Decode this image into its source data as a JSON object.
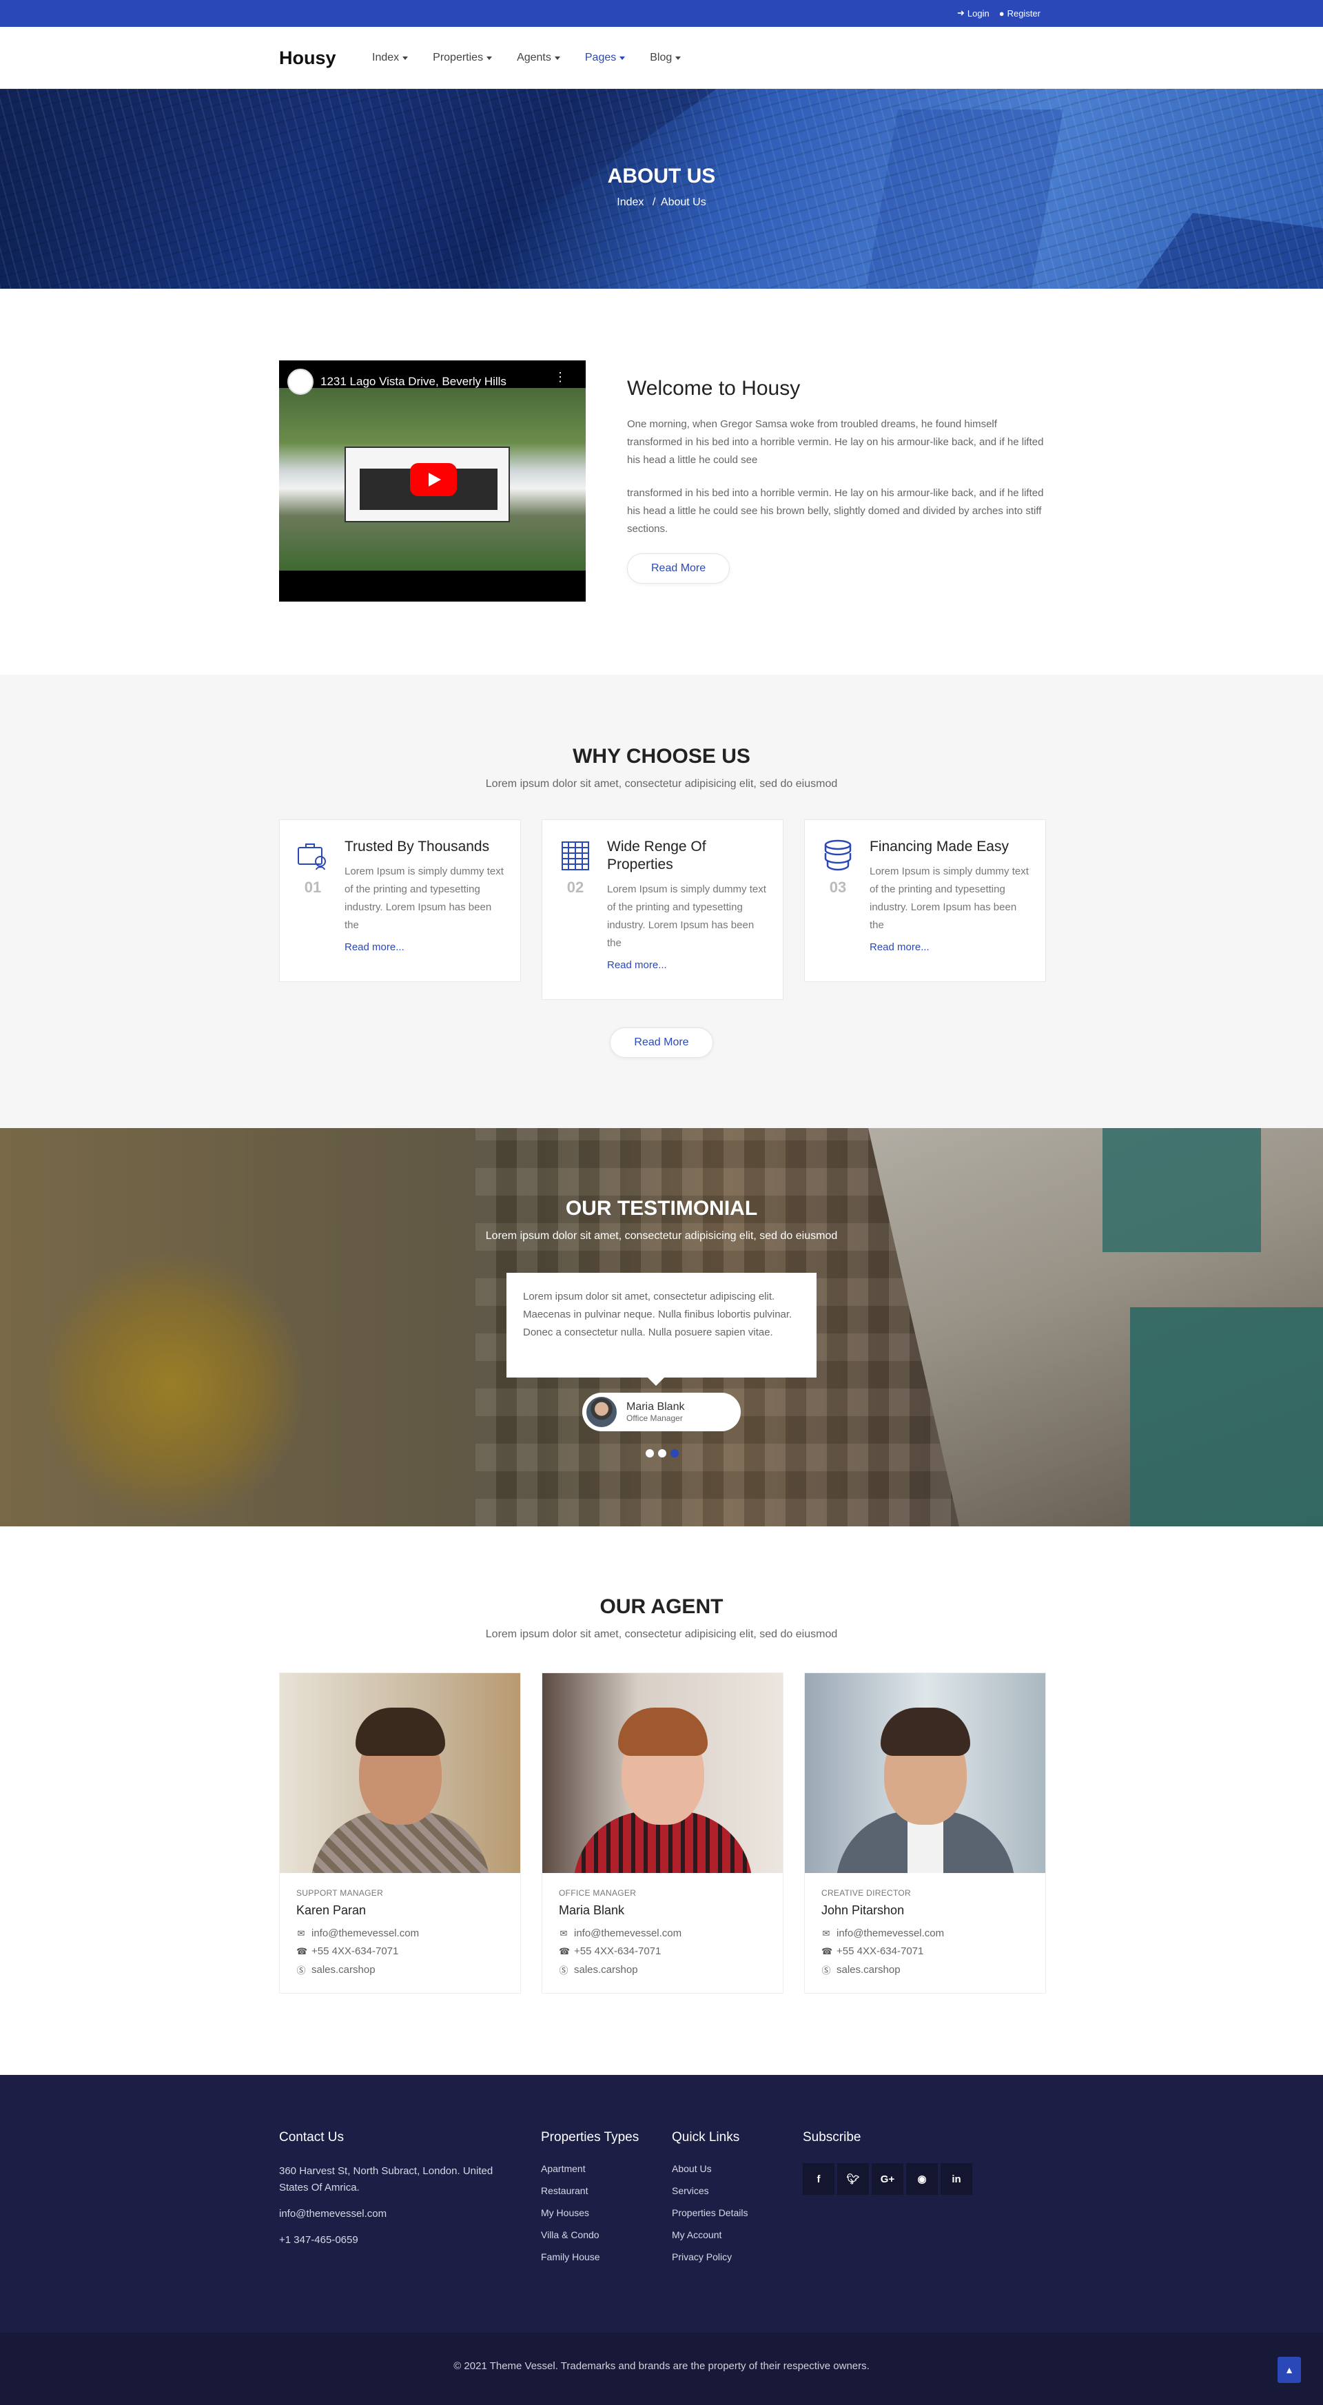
{
  "topbar": {
    "login": "Login",
    "register": "Register"
  },
  "nav": {
    "logo": "Housy",
    "items": [
      {
        "label": "Index",
        "active": false
      },
      {
        "label": "Properties",
        "active": false
      },
      {
        "label": "Agents",
        "active": false
      },
      {
        "label": "Pages",
        "active": true
      },
      {
        "label": "Blog",
        "active": false
      }
    ]
  },
  "hero": {
    "title": "ABOUT US",
    "crumb_home": "Index",
    "crumb_sep": "/",
    "crumb_current": "About Us"
  },
  "about": {
    "video_title": "1231 Lago Vista Drive, Beverly Hills",
    "heading": "Welcome to Housy",
    "p1": "One morning, when Gregor Samsa woke from troubled dreams, he found himself transformed in his bed into a horrible vermin. He lay on his armour-like back, and if he lifted his head a little he could see",
    "p2": "transformed in his bed into a horrible vermin. He lay on his armour-like back, and if he lifted his head a little he could see his brown belly, slightly domed and divided by arches into stiff sections.",
    "button": "Read More"
  },
  "why": {
    "title": "WHY CHOOSE US",
    "subtitle": "Lorem ipsum dolor sit amet, consectetur adipisicing elit, sed do eiusmod",
    "cards": [
      {
        "icon": "briefcase-user-icon",
        "num": "01",
        "title": "Trusted By Thousands",
        "text": "Lorem Ipsum is simply dummy text of the printing and typesetting industry. Lorem Ipsum has been the",
        "link": "Read more..."
      },
      {
        "icon": "building-icon",
        "num": "02",
        "title": "Wide Renge Of Properties",
        "text": "Lorem Ipsum is simply dummy text of the printing and typesetting industry. Lorem Ipsum has been the",
        "link": "Read more..."
      },
      {
        "icon": "coins-icon",
        "num": "03",
        "title": "Financing Made Easy",
        "text": "Lorem Ipsum is simply dummy text of the printing and typesetting industry. Lorem Ipsum has been the",
        "link": "Read more..."
      }
    ],
    "button": "Read More"
  },
  "testimonial": {
    "title": "OUR TESTIMONIAL",
    "subtitle": "Lorem ipsum dolor sit amet, consectetur adipisicing elit, sed do eiusmod",
    "quote": "Lorem ipsum dolor sit amet, consectetur adipiscing elit. Maecenas in pulvinar neque. Nulla finibus lobortis pulvinar. Donec a consectetur nulla. Nulla posuere sapien vitae.",
    "name": "Maria Blank",
    "role": "Office Manager"
  },
  "agents": {
    "title": "OUR AGENT",
    "subtitle": "Lorem ipsum dolor sit amet, consectetur adipisicing elit, sed do eiusmod",
    "list": [
      {
        "role": "SUPPORT MANAGER",
        "name": "Karen Paran",
        "email": "info@themevessel.com",
        "phone": "+55 4XX-634-7071",
        "skype": "sales.carshop"
      },
      {
        "role": "OFFICE MANAGER",
        "name": "Maria Blank",
        "email": "info@themevessel.com",
        "phone": "+55 4XX-634-7071",
        "skype": "sales.carshop"
      },
      {
        "role": "CREATIVE DIRECTOR",
        "name": "John Pitarshon",
        "email": "info@themevessel.com",
        "phone": "+55 4XX-634-7071",
        "skype": "sales.carshop"
      }
    ]
  },
  "footer": {
    "contact": {
      "title": "Contact Us",
      "address": "360 Harvest St, North Subract, London. United States Of Amrica.",
      "email": "info@themevessel.com",
      "phone": "+1 347-465-0659"
    },
    "types": {
      "title": "Properties Types",
      "links": [
        "Apartment",
        "Restaurant",
        "My Houses",
        "Villa & Condo",
        "Family House"
      ]
    },
    "quick": {
      "title": "Quick Links",
      "links": [
        "About Us",
        "Services",
        "Properties Details",
        "My Account",
        "Privacy Policy"
      ]
    },
    "subscribe": {
      "title": "Subscribe",
      "socials": [
        "f",
        "t",
        "G+",
        "rss",
        "in"
      ]
    },
    "copyright": "© 2021 Theme Vessel. Trademarks and brands are the property of their respective owners."
  },
  "colors": {
    "primary": "#2a48b8",
    "footer_bg": "#1d1e45"
  }
}
